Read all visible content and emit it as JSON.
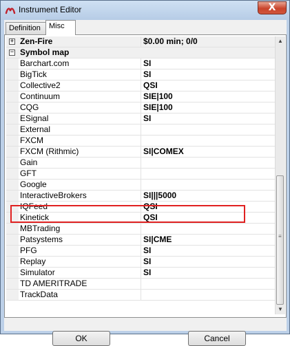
{
  "window": {
    "title": "Instrument Editor",
    "close_glyph": "X",
    "icon": "ninja-logo-icon"
  },
  "tabs": [
    {
      "label": "Definition"
    },
    {
      "label": "Misc"
    }
  ],
  "rows": [
    {
      "type": "category",
      "name": "Zen-Fire",
      "value": "$0.00 min;  0/0",
      "expander": "+"
    },
    {
      "type": "category",
      "name": "Symbol map",
      "value": "",
      "expander": "−"
    },
    {
      "type": "item",
      "name": "Barchart.com",
      "value": "SI"
    },
    {
      "type": "item",
      "name": "BigTick",
      "value": "SI"
    },
    {
      "type": "item",
      "name": "Collective2",
      "value": "QSI"
    },
    {
      "type": "item",
      "name": "Continuum",
      "value": "SIE|100"
    },
    {
      "type": "item",
      "name": "CQG",
      "value": "SIE|100"
    },
    {
      "type": "item",
      "name": "ESignal",
      "value": "SI"
    },
    {
      "type": "item",
      "name": "External",
      "value": ""
    },
    {
      "type": "item",
      "name": "FXCM",
      "value": ""
    },
    {
      "type": "item",
      "name": "FXCM (Rithmic)",
      "value": "SI|COMEX"
    },
    {
      "type": "item",
      "name": "Gain",
      "value": ""
    },
    {
      "type": "item",
      "name": "GFT",
      "value": ""
    },
    {
      "type": "item",
      "name": "Google",
      "value": ""
    },
    {
      "type": "item",
      "name": "InteractiveBrokers",
      "value": "SI|||5000"
    },
    {
      "type": "item",
      "name": "IQFeed",
      "value": "QSI"
    },
    {
      "type": "item",
      "name": "Kinetick",
      "value": "QSI"
    },
    {
      "type": "item",
      "name": "MBTrading",
      "value": ""
    },
    {
      "type": "item",
      "name": "Patsystems",
      "value": "SI|CME"
    },
    {
      "type": "item",
      "name": "PFG",
      "value": "SI"
    },
    {
      "type": "item",
      "name": "Replay",
      "value": "SI"
    },
    {
      "type": "item",
      "name": "Simulator",
      "value": "SI"
    },
    {
      "type": "item",
      "name": "TD AMERITRADE",
      "value": ""
    },
    {
      "type": "item",
      "name": "TrackData",
      "value": ""
    }
  ],
  "scrollbar": {
    "up_glyph": "▲",
    "down_glyph": "▼",
    "grip_glyph": "≡"
  },
  "buttons": {
    "ok": "OK",
    "cancel": "Cancel"
  },
  "colors": {
    "highlight": "#e02020",
    "title_bg": "#bcd0e8",
    "close": "#c9442c"
  }
}
